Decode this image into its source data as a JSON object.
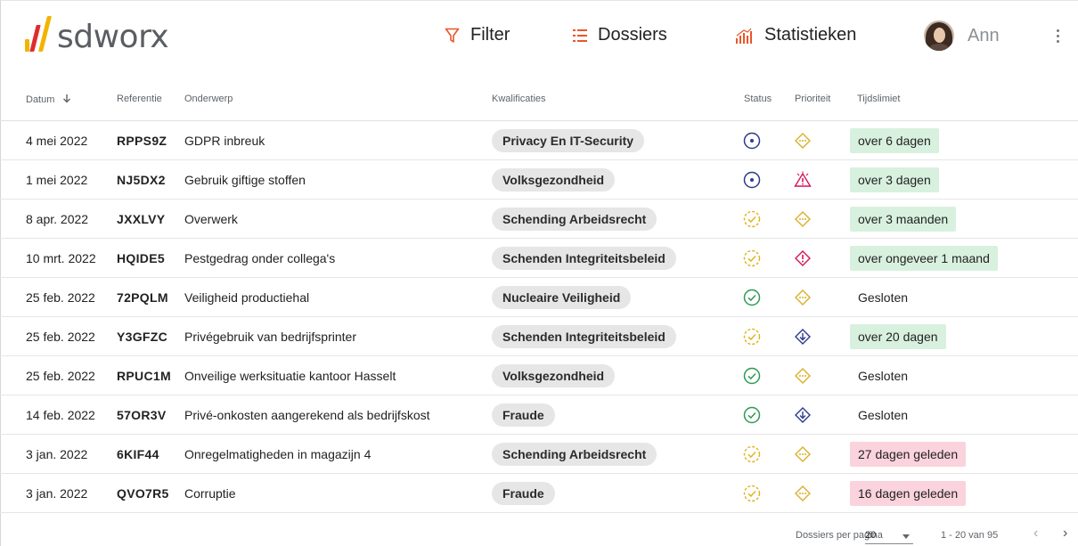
{
  "colors": {
    "accent_orange": "#e8562a",
    "logo_yellow": "#f2b400",
    "logo_red": "#e12b2b",
    "status_blue": "#2d3a8c",
    "status_green": "#2f9a53",
    "status_yellow": "#e2b422",
    "prio_yellow": "#d9b02a",
    "prio_red": "#d4145a",
    "prio_blue": "#2d3a8c",
    "deadline_green": "#d8f1df",
    "deadline_red": "#fbd3dc"
  },
  "header": {
    "logo_text": "sdworx",
    "nav": {
      "filter": "Filter",
      "dossiers": "Dossiers",
      "statistieken": "Statistieken"
    },
    "user_name": "Ann"
  },
  "table": {
    "columns": {
      "datum": "Datum",
      "referentie": "Referentie",
      "onderwerp": "Onderwerp",
      "kwalificaties": "Kwalificaties",
      "status": "Status",
      "prioriteit": "Prioriteit",
      "tijdslimiet": "Tijdslimiet"
    },
    "rows": [
      {
        "date": "4 mei 2022",
        "ref": "RPPS9Z",
        "subject": "GDPR inbreuk",
        "qual": "Privacy En IT-Security",
        "status": "open",
        "prio": "medium",
        "deadline": "over 6 dagen",
        "deadline_kind": "ok"
      },
      {
        "date": "1 mei 2022",
        "ref": "NJ5DX2",
        "subject": "Gebruik giftige stoffen",
        "qual": "Volksgezondheid",
        "status": "open",
        "prio": "critical",
        "deadline": "over 3 dagen",
        "deadline_kind": "ok"
      },
      {
        "date": "8 apr. 2022",
        "ref": "JXXLVY",
        "subject": "Overwerk",
        "qual": "Schending Arbeidsrecht",
        "status": "in-progress",
        "prio": "medium",
        "deadline": "over 3 maanden",
        "deadline_kind": "ok"
      },
      {
        "date": "10 mrt. 2022",
        "ref": "HQIDE5",
        "subject": "Pestgedrag onder collega's",
        "qual": "Schenden Integriteitsbeleid",
        "status": "in-progress",
        "prio": "high",
        "deadline": "over ongeveer 1 maand",
        "deadline_kind": "ok"
      },
      {
        "date": "25 feb. 2022",
        "ref": "72PQLM",
        "subject": "Veiligheid productiehal",
        "qual": "Nucleaire Veiligheid",
        "status": "done",
        "prio": "medium",
        "deadline": "Gesloten",
        "deadline_kind": "closed"
      },
      {
        "date": "25 feb. 2022",
        "ref": "Y3GFZC",
        "subject": "Privégebruik van bedrijfsprinter",
        "qual": "Schenden Integriteitsbeleid",
        "status": "in-progress",
        "prio": "low",
        "deadline": "over 20 dagen",
        "deadline_kind": "ok"
      },
      {
        "date": "25 feb. 2022",
        "ref": "RPUC1M",
        "subject": "Onveilige werksituatie kantoor Hasselt",
        "qual": "Volksgezondheid",
        "status": "done",
        "prio": "medium",
        "deadline": "Gesloten",
        "deadline_kind": "closed"
      },
      {
        "date": "14 feb. 2022",
        "ref": "57OR3V",
        "subject": "Privé-onkosten aangerekend als bedrijfskost",
        "qual": "Fraude",
        "status": "done",
        "prio": "low",
        "deadline": "Gesloten",
        "deadline_kind": "closed"
      },
      {
        "date": "3 jan. 2022",
        "ref": "6KIF44",
        "subject": "Onregelmatigheden in magazijn 4",
        "qual": "Schending Arbeidsrecht",
        "status": "in-progress",
        "prio": "medium",
        "deadline": "27 dagen geleden",
        "deadline_kind": "late"
      },
      {
        "date": "3 jan. 2022",
        "ref": "QVO7R5",
        "subject": "Corruptie",
        "qual": "Fraude",
        "status": "in-progress",
        "prio": "medium",
        "deadline": "16 dagen geleden",
        "deadline_kind": "late"
      }
    ]
  },
  "footer": {
    "per_page_label": "Dossiers per pagina",
    "per_page_value": "20",
    "range": "1 - 20 van 95"
  }
}
